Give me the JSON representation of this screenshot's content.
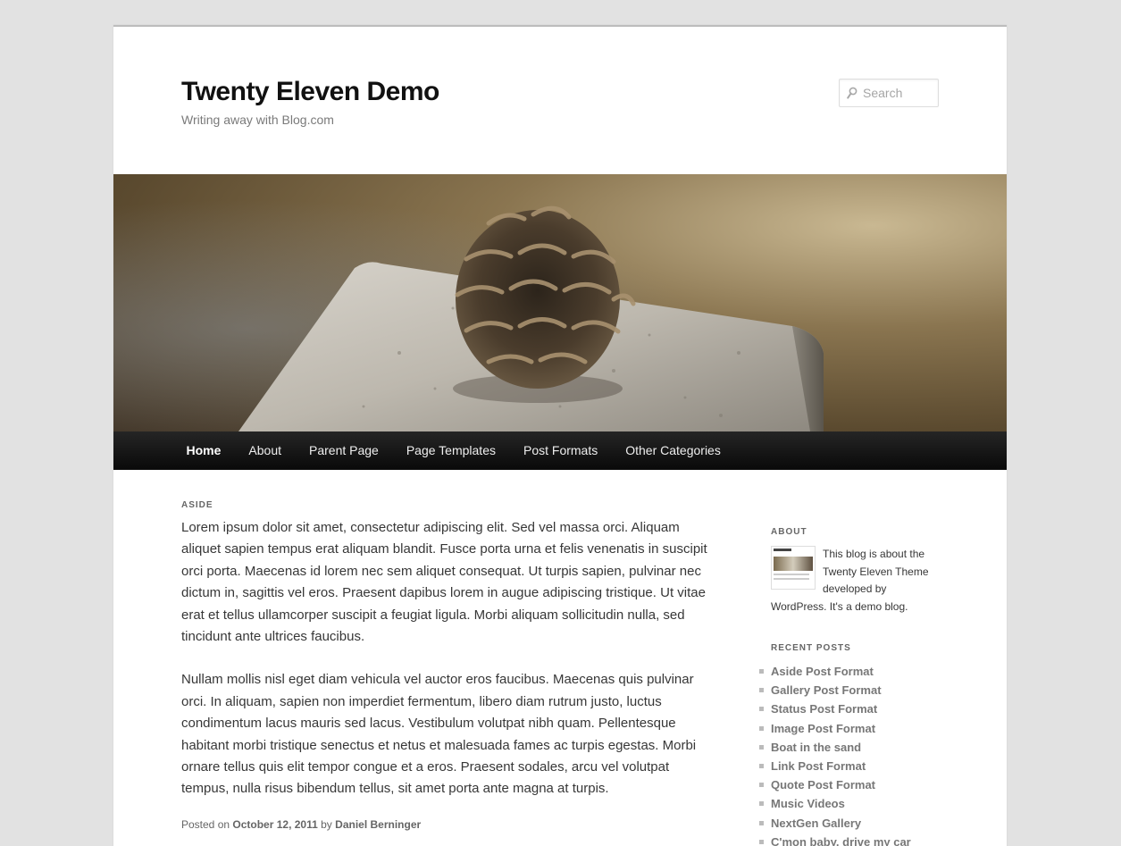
{
  "site": {
    "title": "Twenty Eleven Demo",
    "description": "Writing away with Blog.com"
  },
  "search": {
    "placeholder": "Search",
    "icon": "search-icon"
  },
  "nav": {
    "items": [
      "Home",
      "About",
      "Parent Page",
      "Page Templates",
      "Post Formats",
      "Other Categories"
    ],
    "current": "Home"
  },
  "post": {
    "format_label": "ASIDE",
    "paragraphs": [
      "Lorem ipsum dolor sit amet, consectetur adipiscing elit. Sed vel massa orci. Aliquam aliquet sapien tempus erat aliquam blandit. Fusce porta urna et felis venenatis in suscipit orci porta. Maecenas id lorem nec sem aliquet consequat. Ut turpis sapien, pulvinar nec dictum in, sagittis vel eros. Praesent dapibus lorem in augue adipiscing tristique. Ut vitae erat et tellus ullamcorper suscipit a feugiat ligula. Morbi aliquam sollicitudin nulla, sed tincidunt ante ultrices faucibus.",
      "Nullam mollis nisl eget diam vehicula vel auctor eros faucibus. Maecenas quis pulvinar orci. In aliquam, sapien non imperdiet fermentum, libero diam rutrum justo, luctus condimentum lacus mauris sed lacus. Vestibulum volutpat nibh quam. Pellentesque habitant morbi tristique senectus et netus et malesuada fames ac turpis egestas. Morbi ornare tellus quis elit tempor congue et a eros. Praesent sodales, arcu vel volutpat tempus, nulla risus bibendum tellus, sit amet porta ante magna at turpis."
    ],
    "meta": {
      "posted_on_label": "Posted on",
      "date": "October 12, 2011",
      "by_label": "by",
      "author": "Daniel Berninger"
    }
  },
  "sidebar": {
    "about": {
      "title": "ABOUT",
      "text": "This blog is about the Twenty Eleven Theme developed by WordPress. It's a demo blog."
    },
    "recent_posts": {
      "title": "RECENT POSTS",
      "items": [
        "Aside Post Format",
        "Gallery Post Format",
        "Status Post Format",
        "Image Post Format",
        "Boat in the sand",
        "Link Post Format",
        "Quote Post Format",
        "Music Videos",
        "NextGen Gallery",
        "C'mon baby, drive my car"
      ]
    }
  },
  "colors": {
    "background": "#e2e2e2",
    "nav_bar": "#1a1a1a",
    "title": "#111111",
    "body_text": "#373737"
  }
}
